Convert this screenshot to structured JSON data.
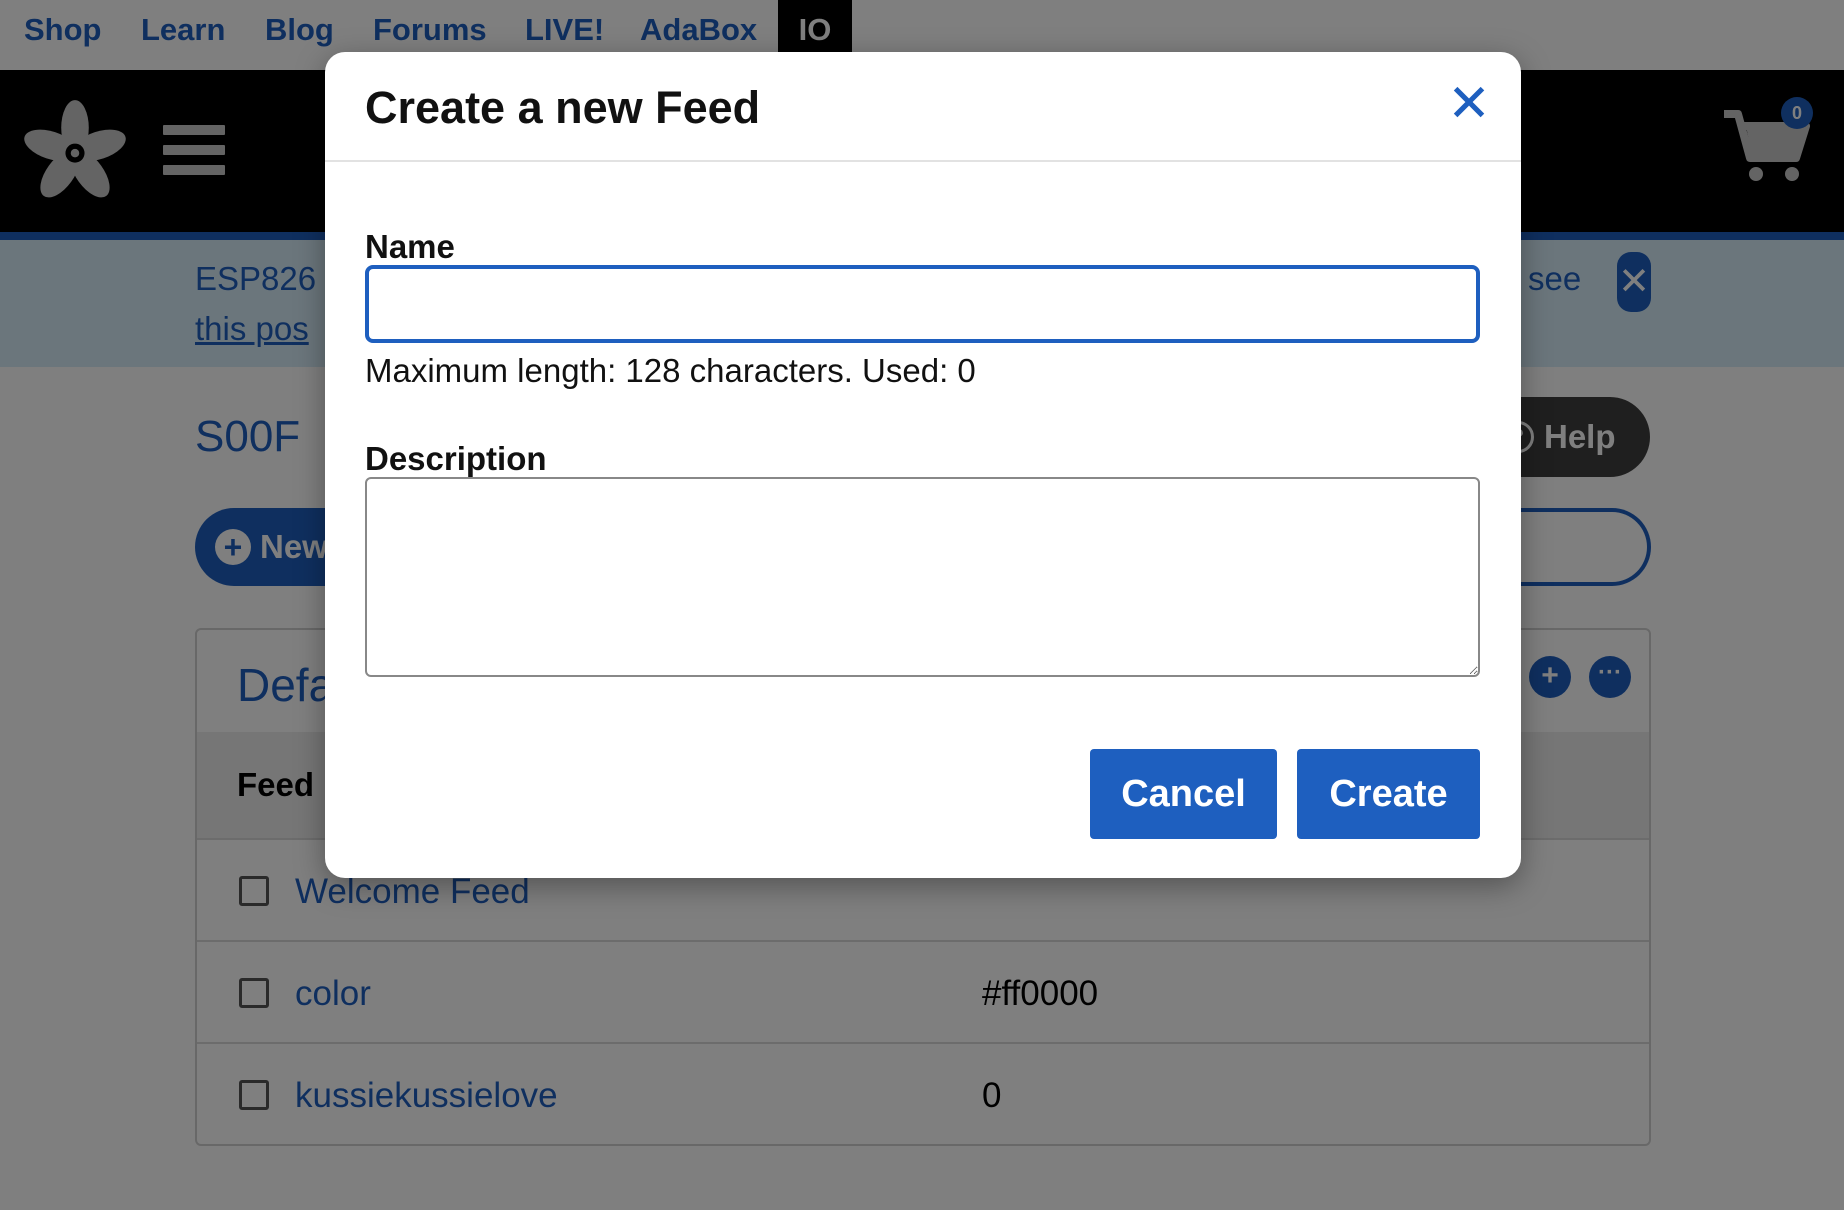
{
  "topnav": {
    "items": [
      "Shop",
      "Learn",
      "Blog",
      "Forums",
      "LIVE!",
      "AdaBox",
      "IO"
    ]
  },
  "header": {
    "cart_count": "0"
  },
  "announcement": {
    "text_start": "ESP826",
    "link_start": "this pos",
    "text_end": "see",
    "close_glyph": "✕"
  },
  "page": {
    "title": "S00F",
    "help_label": "Help",
    "new_label": "New"
  },
  "group": {
    "title": "Defa",
    "column_header": "Feed",
    "add_glyph": "+",
    "more_glyph": "···",
    "rows": [
      {
        "name": "Welcome Feed",
        "value": ""
      },
      {
        "name": "color",
        "value": "#ff0000"
      },
      {
        "name": "kussiekussielove",
        "value": "0"
      }
    ]
  },
  "modal": {
    "title": "Create a new Feed",
    "close_glyph": "✕",
    "name_label": "Name",
    "name_value": "",
    "name_hint": "Maximum length: 128 characters. Used: 0",
    "description_label": "Description",
    "description_value": "",
    "cancel_label": "Cancel",
    "create_label": "Create"
  },
  "colors": {
    "accent": "#1e5fbf",
    "header_bg": "#000000",
    "announcement_bg": "#d7ecf9",
    "overlay": "rgba(0,0,0,0.5)"
  },
  "icons": {
    "logo": "adafruit-flower-logo-icon",
    "menu": "hamburger-menu-icon",
    "cart": "shopping-cart-icon"
  }
}
